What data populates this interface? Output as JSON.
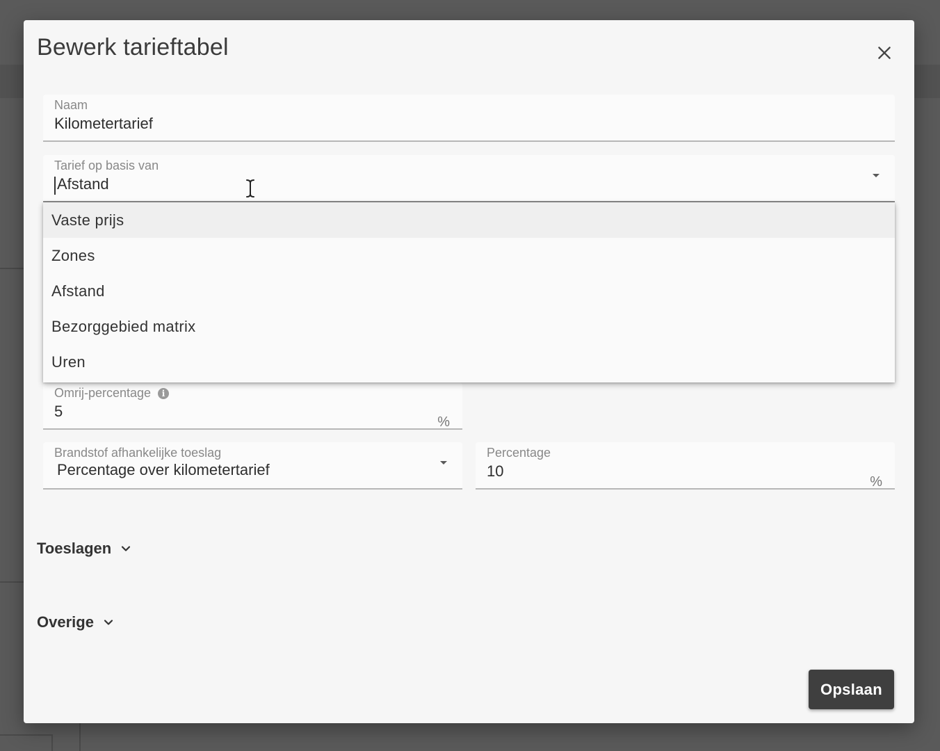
{
  "dialog": {
    "title": "Bewerk tarieftabel",
    "close_icon": "close-icon"
  },
  "fields": {
    "naam": {
      "label": "Naam",
      "value": "Kilometertarief"
    },
    "tarief_basis": {
      "label": "Tarief op basis van",
      "value": "Afstand",
      "options": [
        "Vaste prijs",
        "Zones",
        "Afstand",
        "Bezorggebied matrix",
        "Uren"
      ],
      "highlighted_option": "Vaste prijs"
    },
    "omrij_percentage": {
      "label": "Omrij-percentage",
      "value": "5",
      "suffix": "%",
      "info_icon": "info-icon"
    },
    "brandstof_toeslag": {
      "label": "Brandstof afhankelijke toeslag",
      "value": "Percentage over kilometertarief"
    },
    "percentage": {
      "label": "Percentage",
      "value": "10",
      "suffix": "%"
    }
  },
  "sections": {
    "toeslagen": "Toeslagen",
    "overige": "Overige"
  },
  "actions": {
    "save_label": "Opslaan"
  },
  "colors": {
    "overlay": "#5a5a5a",
    "dialog_bg": "#f6f6f6",
    "primary_button": "#3f3f3f"
  }
}
